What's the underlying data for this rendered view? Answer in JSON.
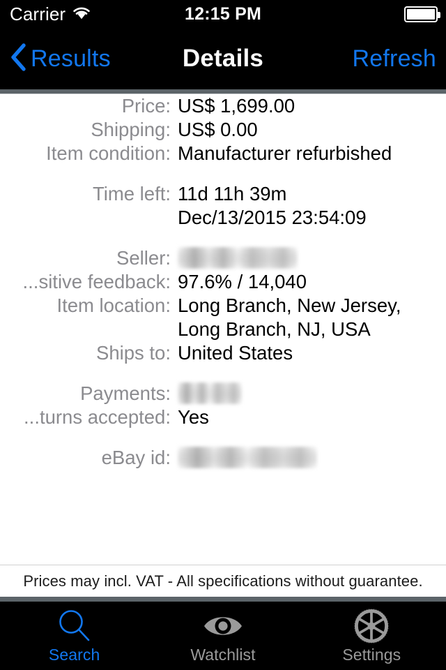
{
  "status_bar": {
    "carrier": "Carrier",
    "wifi_icon": "wifi-icon",
    "time": "12:15 PM",
    "battery_icon": "battery-full-icon"
  },
  "nav_bar": {
    "back_icon": "chevron-left-icon",
    "back_label": "Results",
    "title": "Details",
    "refresh_label": "Refresh",
    "tint_color": "#1277ef"
  },
  "details": {
    "groups": [
      {
        "rows": [
          {
            "label": "Price:",
            "value": "US$ 1,699.00",
            "redacted": false
          },
          {
            "label": "Shipping:",
            "value": "US$ 0.00",
            "redacted": false
          },
          {
            "label": "Item condition:",
            "value": "Manufacturer refurbished",
            "redacted": false
          }
        ]
      },
      {
        "rows": [
          {
            "label": "Time left:",
            "value": "11d 11h 39m\nDec/13/2015 23:54:09",
            "redacted": false
          }
        ]
      },
      {
        "rows": [
          {
            "label": "Seller:",
            "value": "",
            "redacted": true
          },
          {
            "label": "...sitive feedback:",
            "value": "97.6% / 14,040",
            "redacted": false
          },
          {
            "label": "Item location:",
            "value": "Long Branch, New Jersey, Long Branch, NJ, USA",
            "redacted": false
          },
          {
            "label": "Ships to:",
            "value": "United States",
            "redacted": false
          }
        ]
      },
      {
        "rows": [
          {
            "label": "Payments:",
            "value": "",
            "redacted": true
          },
          {
            "label": "...turns accepted:",
            "value": "Yes",
            "redacted": false
          }
        ]
      },
      {
        "rows": [
          {
            "label": "eBay id:",
            "value": "",
            "redacted": true
          }
        ]
      }
    ]
  },
  "footer": {
    "note": "Prices may incl. VAT - All specifications without guarantee."
  },
  "tab_bar": {
    "items": [
      {
        "label": "Search",
        "icon": "magnifier-icon",
        "active": true
      },
      {
        "label": "Watchlist",
        "icon": "eye-icon",
        "active": false
      },
      {
        "label": "Settings",
        "icon": "gear-icon",
        "active": false
      }
    ],
    "active_color": "#1277ef",
    "inactive_color": "#9a9a9a"
  }
}
